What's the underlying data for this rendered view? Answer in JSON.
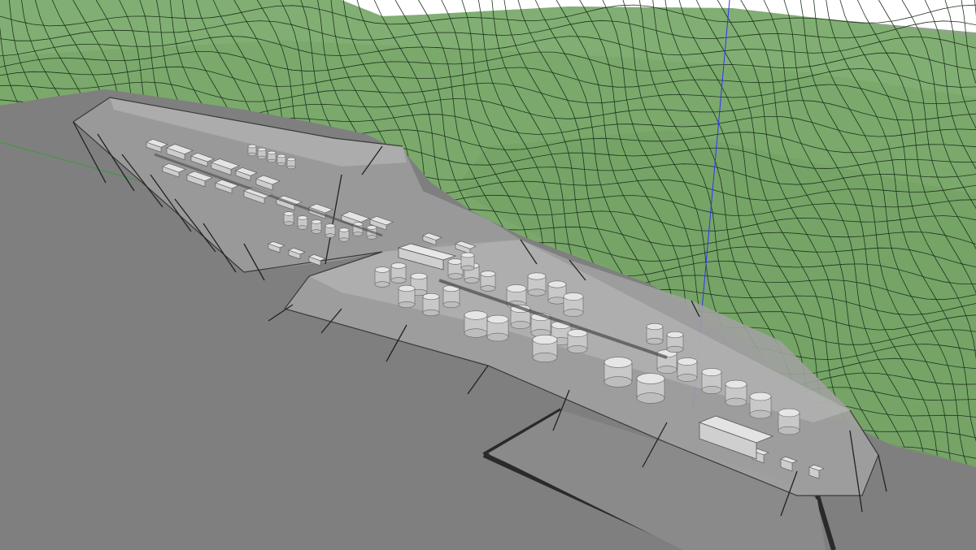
{
  "scene": {
    "view": "3d-viewport",
    "sky_color": "#ffffff",
    "ground_color": "#7f7f7f",
    "terrain_color": "#79a86a",
    "terrain_grid_color": "#223b22",
    "enclosure_color": "#9a9a9a",
    "structure_color": "#d8d8d8",
    "axis_blue": "#2a2aff",
    "axis_green": "#22aa22"
  },
  "objects": {
    "terrain": "terrain-mesh",
    "enclosure_upper": "enclosure-upper",
    "enclosure_lower": "enclosure-lower",
    "tanks": "storage-tanks",
    "buildings": "process-buildings",
    "road": "site-road"
  }
}
